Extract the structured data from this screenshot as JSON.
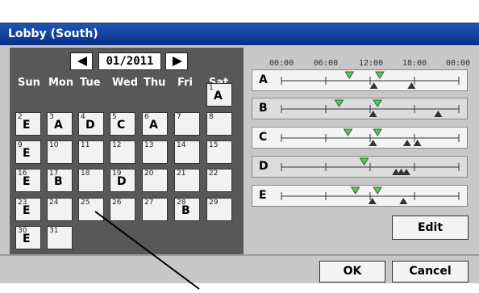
{
  "window": {
    "title": "Lobby (South)"
  },
  "calendar": {
    "month": "01/2011",
    "day_headers": [
      "Sun",
      "Mon",
      "Tue",
      "Wed",
      "Thu",
      "Fri",
      "Sat"
    ],
    "weeks": [
      [
        null,
        null,
        null,
        null,
        null,
        null,
        {
          "day": "1",
          "pattern": "A"
        }
      ],
      [
        {
          "day": "2",
          "pattern": "E"
        },
        {
          "day": "3",
          "pattern": "A"
        },
        {
          "day": "4",
          "pattern": "D"
        },
        {
          "day": "5",
          "pattern": "C"
        },
        {
          "day": "6",
          "pattern": "A"
        },
        {
          "day": "7",
          "pattern": ""
        },
        {
          "day": "8",
          "pattern": ""
        }
      ],
      [
        {
          "day": "9",
          "pattern": "E"
        },
        {
          "day": "10",
          "pattern": ""
        },
        {
          "day": "11",
          "pattern": ""
        },
        {
          "day": "12",
          "pattern": ""
        },
        {
          "day": "13",
          "pattern": ""
        },
        {
          "day": "14",
          "pattern": ""
        },
        {
          "day": "15",
          "pattern": ""
        }
      ],
      [
        {
          "day": "16",
          "pattern": "E"
        },
        {
          "day": "17",
          "pattern": "B"
        },
        {
          "day": "18",
          "pattern": ""
        },
        {
          "day": "19",
          "pattern": "D"
        },
        {
          "day": "20",
          "pattern": ""
        },
        {
          "day": "21",
          "pattern": ""
        },
        {
          "day": "22",
          "pattern": ""
        }
      ],
      [
        {
          "day": "23",
          "pattern": "E"
        },
        {
          "day": "24",
          "pattern": ""
        },
        {
          "day": "25",
          "pattern": ""
        },
        {
          "day": "26",
          "pattern": ""
        },
        {
          "day": "27",
          "pattern": ""
        },
        {
          "day": "28",
          "pattern": "B"
        },
        {
          "day": "29",
          "pattern": ""
        }
      ],
      [
        {
          "day": "30",
          "pattern": "E"
        },
        {
          "day": "31",
          "pattern": ""
        },
        null,
        null,
        null,
        null,
        null
      ]
    ]
  },
  "timeline": {
    "hours": [
      "00:00",
      "06:00",
      "12:00",
      "18:00",
      "00:00"
    ],
    "patterns": [
      {
        "label": "A",
        "green": [
          9.2,
          13.3
        ],
        "black": [
          12.5,
          17.6
        ]
      },
      {
        "label": "B",
        "green": [
          7.8,
          13.0
        ],
        "black": [
          12.4,
          21.2
        ]
      },
      {
        "label": "C",
        "green": [
          9.0,
          13.0
        ],
        "black": [
          12.4,
          17.0,
          18.4
        ]
      },
      {
        "label": "D",
        "green": [
          11.2
        ],
        "black": [
          15.5,
          16.2,
          16.9
        ]
      },
      {
        "label": "E",
        "green": [
          10.0,
          13.0
        ],
        "black": [
          12.3,
          16.5
        ]
      }
    ],
    "colors": {
      "on_marker": "#5cc46a",
      "off_marker": "#333333"
    }
  },
  "buttons": {
    "edit": "Edit",
    "ok": "OK",
    "cancel": "Cancel"
  }
}
